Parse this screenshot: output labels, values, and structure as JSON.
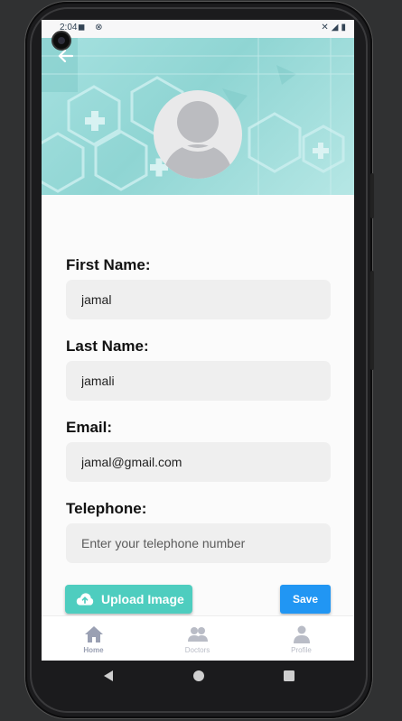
{
  "status_bar": {
    "time": "2:04",
    "left_icons": "◼ ⊗",
    "right_icons": "✕◢▮"
  },
  "header": {
    "back_icon": "arrow-left-icon",
    "avatar_icon": "person-silhouette-icon"
  },
  "form": {
    "first_name": {
      "label": "First Name:",
      "value": "jamal",
      "placeholder": ""
    },
    "last_name": {
      "label": "Last Name:",
      "value": "jamali",
      "placeholder": ""
    },
    "email": {
      "label": "Email:",
      "value": "jamal@gmail.com",
      "placeholder": ""
    },
    "telephone": {
      "label": "Telephone:",
      "value": "",
      "placeholder": "Enter your telephone number"
    }
  },
  "actions": {
    "upload_label": "Upload Image",
    "upload_icon": "cloud-upload-icon",
    "save_label": "Save"
  },
  "bottom_nav": {
    "items": [
      {
        "label": "Home",
        "icon": "home-icon",
        "active": true
      },
      {
        "label": "Doctors",
        "icon": "people-icon",
        "active": false
      },
      {
        "label": "Profile",
        "icon": "person-icon",
        "active": false
      }
    ]
  },
  "colors": {
    "header_teal": "#9fdcdb",
    "upload_button": "#4ecdbf",
    "save_button": "#2196f3",
    "field_background": "#efefef"
  }
}
